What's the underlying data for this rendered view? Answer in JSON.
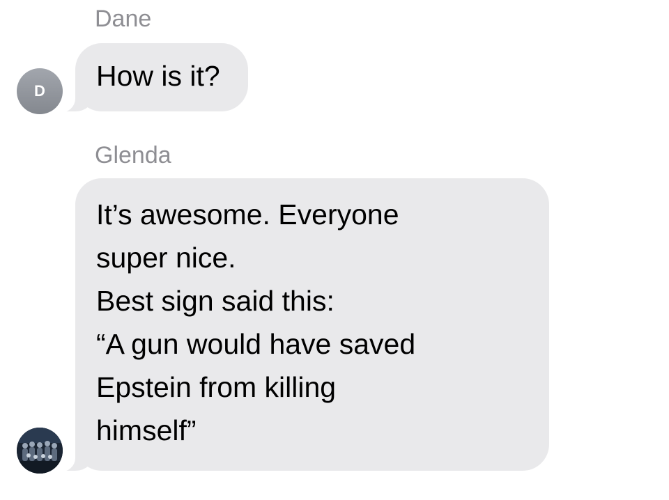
{
  "conversation": {
    "messages": [
      {
        "sender": "Dane",
        "avatar_initial": "D",
        "text": "How is it?"
      },
      {
        "sender": "Glenda",
        "avatar_icon": "group-photo",
        "text": "It’s awesome. Everyone\nsuper nice.\nBest sign said this:\n“A gun would have saved\nEpstein from killing\nhimself”"
      }
    ]
  },
  "colors": {
    "bubble": "#e9e9eb",
    "sender_name": "#8e8e93",
    "background": "#ffffff"
  }
}
